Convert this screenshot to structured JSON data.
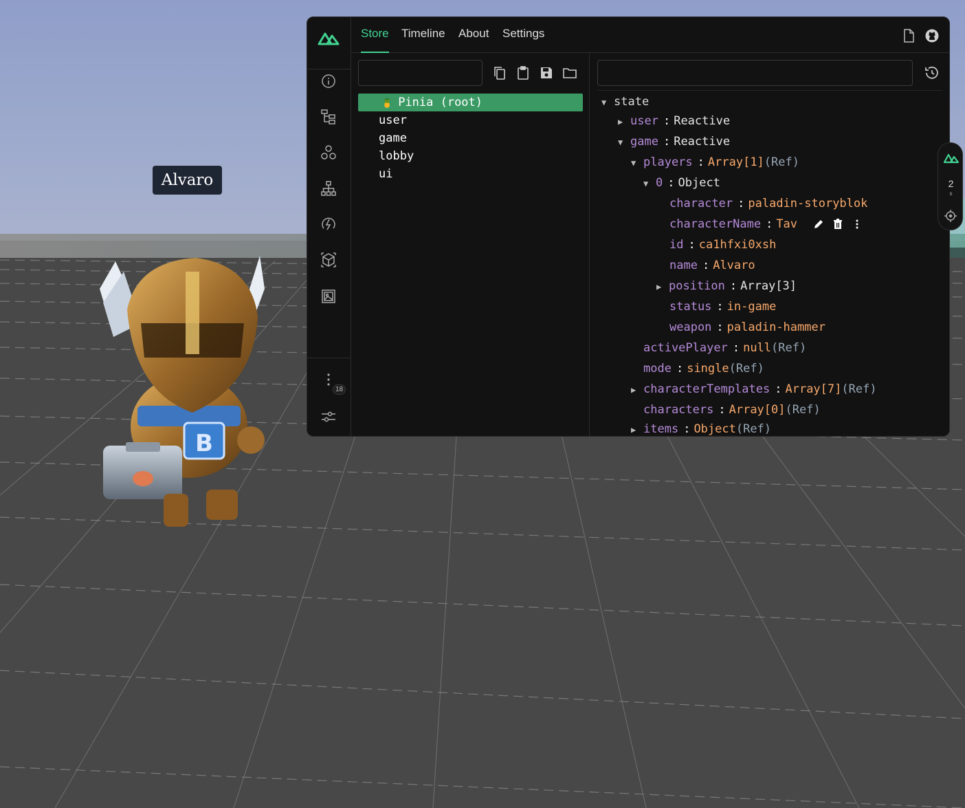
{
  "scene": {
    "player_label": "Alvaro"
  },
  "devtools": {
    "tabs": [
      {
        "label": "Store",
        "active": true
      },
      {
        "label": "Timeline",
        "active": false
      },
      {
        "label": "About",
        "active": false
      },
      {
        "label": "Settings",
        "active": false
      }
    ],
    "side_nav": {
      "icons": [
        "info-icon",
        "component-tree-icon",
        "modules-icon",
        "hierarchy-icon",
        "performance-icon",
        "package-icon",
        "assets-icon"
      ],
      "more_badge": "18",
      "bottom_icon": "settings-sliders-icon"
    },
    "top_right_icons": [
      "document-icon",
      "github-icon"
    ],
    "store_pane": {
      "filter_placeholder": "",
      "toolbar_icons": [
        "copy-icon",
        "paste-icon",
        "save-icon",
        "folder-icon"
      ],
      "stores": [
        {
          "label": "Pinia (root)",
          "selected": true,
          "icon": "🍍"
        },
        {
          "label": "user",
          "selected": false
        },
        {
          "label": "game",
          "selected": false
        },
        {
          "label": "lobby",
          "selected": false
        },
        {
          "label": "ui",
          "selected": false
        }
      ]
    },
    "state_pane": {
      "filter_placeholder": "",
      "tree": {
        "root": "state",
        "user_key": "user",
        "user_type": "Reactive",
        "game_key": "game",
        "game_type": "Reactive",
        "players_key": "players",
        "players_type": "Array[1]",
        "players_ref": "(Ref)",
        "p0_key": "0",
        "p0_type": "Object",
        "character_key": "character",
        "character_val": "paladin-storyblok",
        "characterName_key": "characterName",
        "characterName_val": "Tav",
        "id_key": "id",
        "id_val": "ca1hfxi0xsh",
        "name_key": "name",
        "name_val": "Alvaro",
        "position_key": "position",
        "position_type": "Array[3]",
        "status_key": "status",
        "status_val": "in-game",
        "weapon_key": "weapon",
        "weapon_val": "paladin-hammer",
        "activePlayer_key": "activePlayer",
        "activePlayer_val": "null",
        "activePlayer_ref": "(Ref)",
        "mode_key": "mode",
        "mode_val": "single",
        "mode_ref": "(Ref)",
        "characterTemplates_key": "characterTemplates",
        "characterTemplates_val": "Array[7]",
        "characterTemplates_ref": "(Ref)",
        "characters_key": "characters",
        "characters_val": "Array[0]",
        "characters_ref": "(Ref)",
        "items_key": "items",
        "items_val": "Object",
        "items_ref": "(Ref)"
      }
    }
  },
  "floating_button": {
    "count": "2",
    "unit": "s"
  },
  "colors": {
    "accent": "#42d392",
    "selected_row": "#3b9a64",
    "key": "#b58ad8",
    "value": "#f7a86b"
  }
}
